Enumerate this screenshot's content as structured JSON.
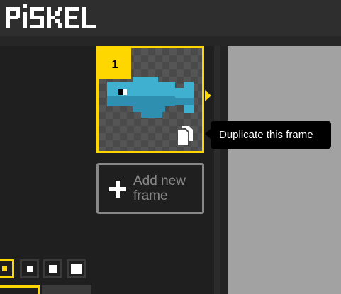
{
  "app": {
    "logo_text": "PiSKEL"
  },
  "frames": [
    {
      "number": "1",
      "selected": true
    }
  ],
  "frame_actions": {
    "duplicate_tooltip": "Duplicate this frame"
  },
  "add_frame": {
    "label": "Add new frame"
  },
  "pen_sizes": {
    "options": [
      "1",
      "2",
      "3",
      "4"
    ],
    "selected_index": 0
  },
  "colors": {
    "accent": "#ffd700",
    "header_bg": "#2e2e2e",
    "panel_bg": "#1f1f1f",
    "canvas_bg": "#a2a2a2",
    "fish_body": "#3fb0d0",
    "fish_shade": "#2e8fb0"
  },
  "icons": {
    "duplicate": "duplicate-icon",
    "add": "plus-icon"
  }
}
